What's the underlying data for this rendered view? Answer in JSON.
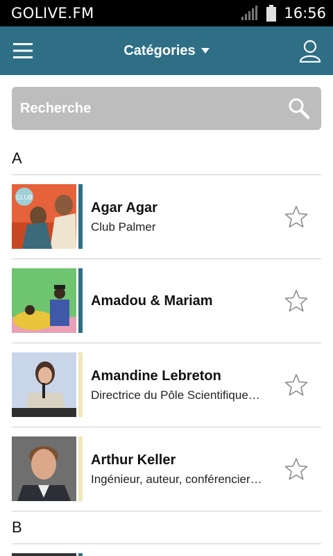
{
  "status_bar": {
    "app_name": "GOLIVE.FM",
    "time": "16:56",
    "icons": [
      "signal-icon",
      "battery-icon"
    ]
  },
  "app_bar": {
    "title": "Catégories",
    "icons": [
      "menu-icon",
      "caret-down-icon",
      "user-icon"
    ],
    "color": "#2e6f86"
  },
  "search": {
    "placeholder": "Recherche",
    "icon": "search-icon"
  },
  "sections": [
    {
      "letter": "A",
      "items": [
        {
          "title": "Agar Agar",
          "subtitle": "Club Palmer",
          "bar_color": "#2e6f86",
          "favorite": false
        },
        {
          "title": "Amadou & Mariam",
          "subtitle": "",
          "bar_color": "#2e6f86",
          "favorite": false
        },
        {
          "title": "Amandine Lebreton",
          "subtitle": "Directrice du Pôle Scientifique…",
          "bar_color": "#efe6b8",
          "favorite": false
        },
        {
          "title": "Arthur Keller",
          "subtitle": "Ingénieur, auteur, conférencier…",
          "bar_color": "#efe6b8",
          "favorite": false
        }
      ]
    },
    {
      "letter": "B",
      "items": []
    }
  ]
}
